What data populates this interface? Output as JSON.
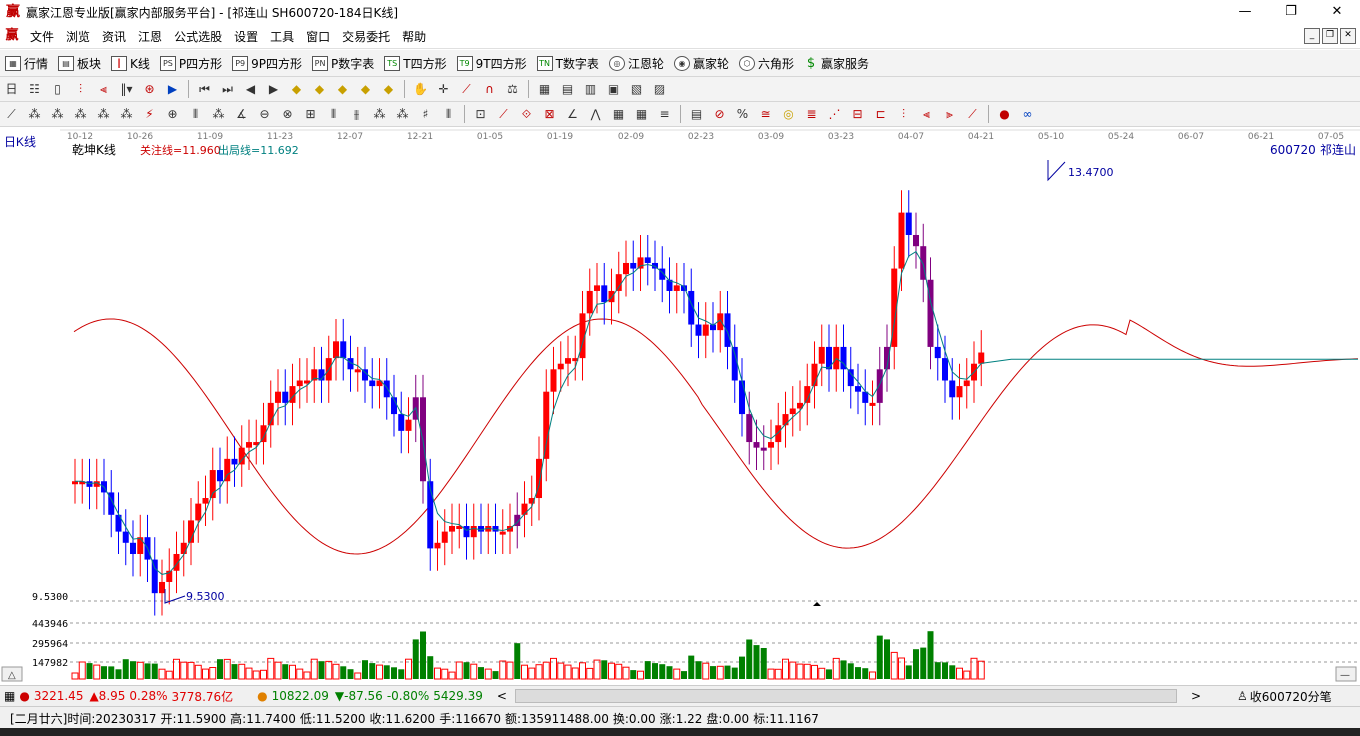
{
  "window": {
    "title": "赢家江恩专业版[赢家内部服务平台] - [祁连山  SH600720-184日K线]",
    "app_icon": "赢",
    "minimize": "—",
    "maximize": "❐",
    "close": "✕"
  },
  "menu": {
    "logo": "赢",
    "items": [
      "文件",
      "浏览",
      "资讯",
      "江恩",
      "公式选股",
      "设置",
      "工具",
      "窗口",
      "交易委托",
      "帮助"
    ]
  },
  "toolbar": {
    "items": [
      {
        "label": "行情",
        "icon": "grid-icon"
      },
      {
        "label": "板块",
        "icon": "blocks-icon"
      },
      {
        "label": "K线",
        "icon": "kline-icon"
      },
      {
        "label": "P四方形",
        "icon": "p-square-icon"
      },
      {
        "label": "9P四方形",
        "icon": "9p-square-icon"
      },
      {
        "label": "P数字表",
        "icon": "p-table-icon"
      },
      {
        "label": "T四方形",
        "icon": "t-square-icon"
      },
      {
        "label": "9T四方形",
        "icon": "9t-square-icon"
      },
      {
        "label": "T数字表",
        "icon": "t-table-icon"
      },
      {
        "label": "江恩轮",
        "icon": "gann-wheel-icon"
      },
      {
        "label": "赢家轮",
        "icon": "winner-wheel-icon"
      },
      {
        "label": "六角形",
        "icon": "hexagon-icon"
      },
      {
        "label": "赢家服务",
        "icon": "dollar-icon"
      }
    ]
  },
  "chart_header": {
    "period": "日K线",
    "indicator": "乾坤K线",
    "attention_line": "关注线=11.960",
    "exit_line": "出局线=11.692",
    "stock_code": "600720",
    "stock_name": "祁连山"
  },
  "chart_data": {
    "type": "candlestick",
    "dates": [
      "10-12",
      "10-26",
      "11-09",
      "11-23",
      "12-07",
      "12-21",
      "01-05",
      "01-19",
      "02-09",
      "02-23",
      "03-09",
      "03-23",
      "04-07",
      "04-21",
      "05-10",
      "05-24",
      "06-07",
      "06-21",
      "07-05"
    ],
    "price_labels": {
      "high": "13.4700",
      "low": "9.5300"
    },
    "price_range": [
      9.53,
      13.47
    ],
    "volume_ticks": [
      "9.5300",
      "443946",
      "295964",
      "147982"
    ],
    "colors": {
      "up": "#ff0000",
      "down": "#0000ff",
      "special": "#800080",
      "volume_up": "#ff0000",
      "volume_down": "#008000",
      "slow_line": "#cc0000",
      "fast_line": "#008080"
    },
    "slow_line": "sinusoidal red line, flattens to ~11.69 at right",
    "fast_line": "teal line tracking closes"
  },
  "index_bar": {
    "sh_value": "3221.45",
    "sh_change": "▲8.95",
    "sh_pct": "0.28%",
    "sh_amount": "3778.76亿",
    "sz_value": "10822.09",
    "sz_change": "▼-87.56",
    "sz_pct": "-0.80%",
    "sz_amount": "5429.39",
    "tick_label": "收600720分笔"
  },
  "status": {
    "lunar": "[二月廿六]",
    "time": "时间:20230317",
    "open": "开:11.5900",
    "high": "高:11.7400",
    "low": "低:11.5200",
    "close": "收:11.6200",
    "hands": "手:116670",
    "amount": "额:135911488.00",
    "turnover": "换:0.00",
    "rise": "涨:1.22",
    "pan": "盘:0.00",
    "mark": "标:11.1167"
  }
}
